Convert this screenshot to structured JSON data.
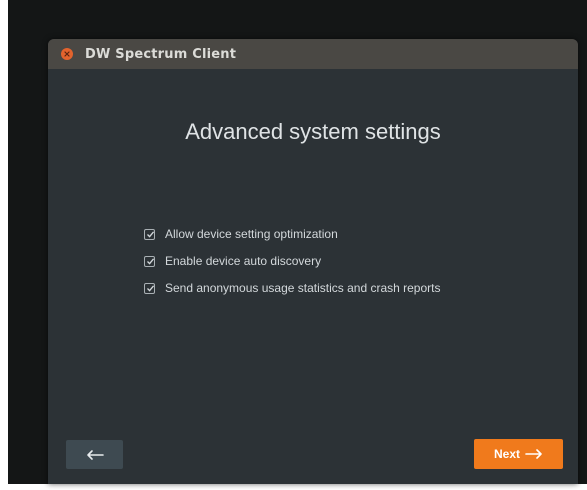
{
  "window": {
    "title": "DW Spectrum Client"
  },
  "page": {
    "heading": "Advanced system settings"
  },
  "options": [
    {
      "label": "Allow device setting optimization",
      "checked": true
    },
    {
      "label": "Enable device auto discovery",
      "checked": true
    },
    {
      "label": "Send anonymous usage statistics and crash reports",
      "checked": true
    }
  ],
  "footer": {
    "back_icon": "left-arrow-icon",
    "next_label": "Next",
    "next_icon": "right-arrow-icon"
  },
  "colors": {
    "accent": "#f07a1c",
    "close": "#e3632d",
    "window_bg": "#2c3236",
    "titlebar_bg": "#4a4844"
  }
}
